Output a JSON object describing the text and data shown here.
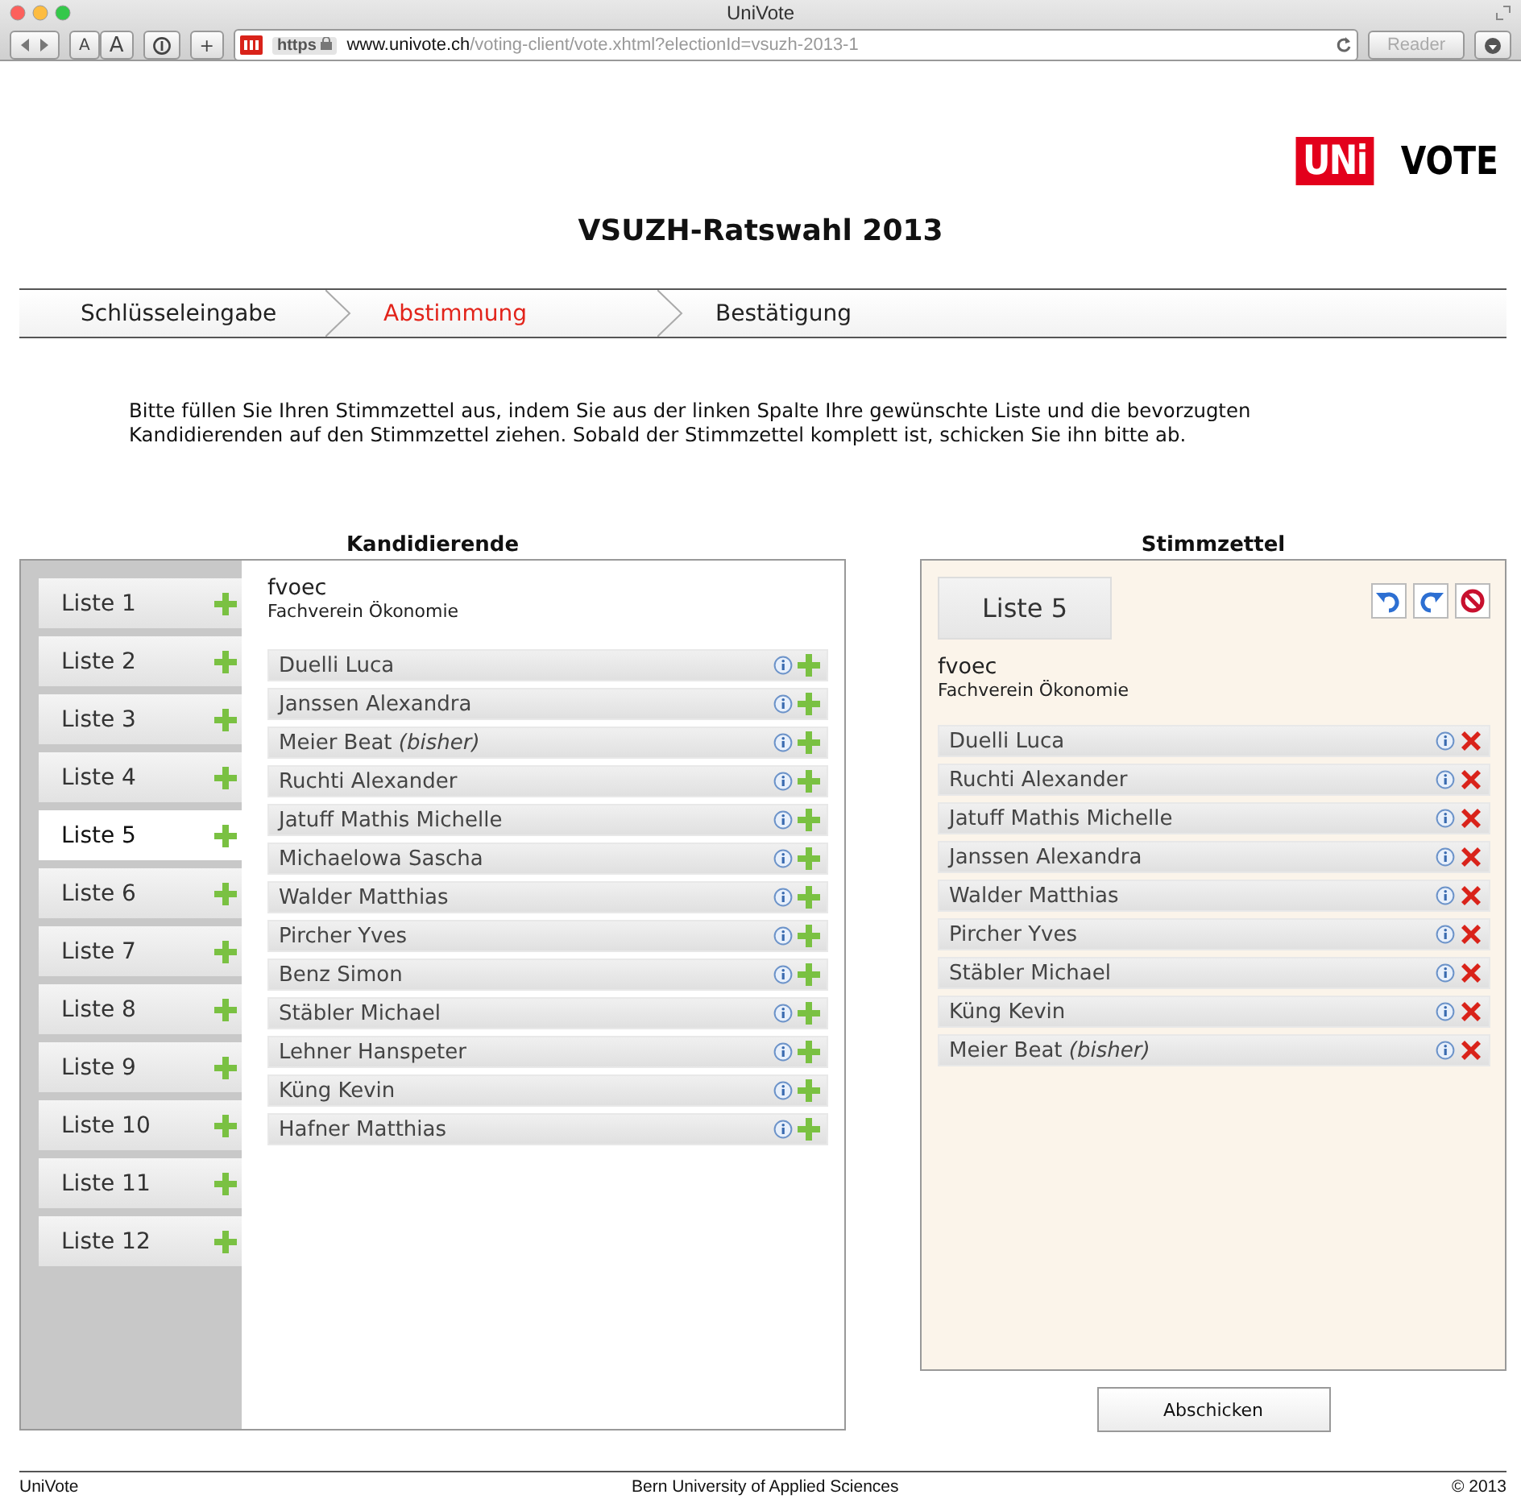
{
  "window": {
    "title": "UniVote"
  },
  "toolbar": {
    "font_smaller": "A",
    "font_larger": "A",
    "add": "+",
    "url_scheme": "https",
    "url_host": "www.univote.ch",
    "url_path": "/voting-client/vote.xhtml?electionId=vsuzh-2013-1",
    "reader": "Reader"
  },
  "logo": {
    "mark": "UNi",
    "word": "VOTE"
  },
  "title": "VSUZH-Ratswahl 2013",
  "steps": [
    {
      "label": "Schlüsseleingabe",
      "selected": false
    },
    {
      "label": "Abstimmung",
      "selected": true
    },
    {
      "label": "Bestätigung",
      "selected": false
    }
  ],
  "instructions": "Bitte füllen Sie Ihren Stimmzettel aus, indem Sie aus der linken Spalte Ihre gewünschte Liste und die bevorzugten Kandidierenden auf den Stimmzettel ziehen. Sobald der Stimmzettel komplett ist, schicken Sie ihn bitte ab.",
  "candidates_panel": {
    "heading": "Kandidierende",
    "lists": [
      {
        "label": "Liste 1",
        "selected": false
      },
      {
        "label": "Liste 2",
        "selected": false
      },
      {
        "label": "Liste 3",
        "selected": false
      },
      {
        "label": "Liste 4",
        "selected": false
      },
      {
        "label": "Liste 5",
        "selected": true
      },
      {
        "label": "Liste 6",
        "selected": false
      },
      {
        "label": "Liste 7",
        "selected": false
      },
      {
        "label": "Liste 8",
        "selected": false
      },
      {
        "label": "Liste 9",
        "selected": false
      },
      {
        "label": "Liste 10",
        "selected": false
      },
      {
        "label": "Liste 11",
        "selected": false
      },
      {
        "label": "Liste 12",
        "selected": false
      }
    ],
    "party": {
      "short": "fvoec",
      "name": "Fachverein Ökonomie"
    },
    "candidates": [
      "Duelli Luca",
      "Janssen Alexandra",
      "Meier Beat *(bisher)*",
      "Ruchti Alexander",
      "Jatuff Mathis Michelle",
      "Michaelowa Sascha",
      "Walder Matthias",
      "Pircher Yves",
      "Benz Simon",
      "Stäbler Michael",
      "Lehner Hanspeter",
      "Küng Kevin",
      "Hafner Matthias"
    ]
  },
  "ballot": {
    "heading": "Stimmzettel",
    "list": "Liste 5",
    "party": {
      "short": "fvoec",
      "name": "Fachverein Ökonomie"
    },
    "candidates": [
      "Duelli Luca",
      "Ruchti Alexander",
      "Jatuff Mathis Michelle",
      "Janssen Alexandra",
      "Walder Matthias",
      "Pircher Yves",
      "Stäbler Michael",
      "Küng Kevin",
      "Meier Beat *(bisher)*"
    ],
    "submit": "Abschicken"
  },
  "footer": {
    "left": "UniVote",
    "center": "Bern University of Applied Sciences",
    "right": "© 2013"
  }
}
